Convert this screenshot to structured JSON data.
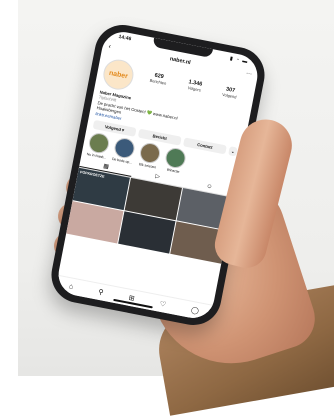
{
  "status": {
    "time": "14:46",
    "icons": "▮ ◔ ▬"
  },
  "header": {
    "username": "naber.nl",
    "back_icon": "‹",
    "more_icon": "⋯"
  },
  "profile": {
    "logo_text": "naber",
    "stats": [
      {
        "n": "629",
        "l": "Berichten"
      },
      {
        "n": "1.346",
        "l": "Volgers"
      },
      {
        "n": "307",
        "l": "Volgend"
      }
    ],
    "bio": {
      "name": "Naber Magazine",
      "category": "Tijdschrift",
      "line1": "De pracht van het Oosten! 💚 www.naber.nl",
      "line2": "Haaksbergen",
      "link": "linktr.ee/naber"
    }
  },
  "buttons": [
    "Volgend ▾",
    "Bericht",
    "Contact",
    "⌄"
  ],
  "highlights": [
    "Nu in Naab...",
    "De bode op...",
    "Elk seizoen",
    "Winactie"
  ],
  "tabs": [
    "▦",
    "▷",
    "☺"
  ],
  "grid_captions": [
    "POPKROETZE",
    "",
    "",
    "",
    "",
    ""
  ],
  "nav_icons": [
    "⌂",
    "⚲",
    "⊞",
    "♡",
    "◯"
  ]
}
